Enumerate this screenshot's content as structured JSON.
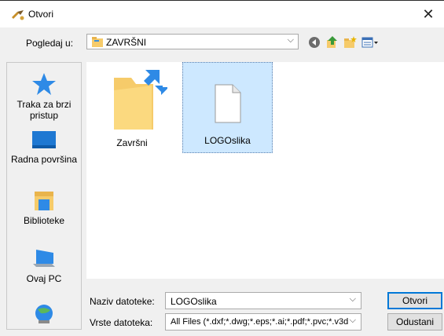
{
  "window": {
    "title": "Otvori",
    "close_symbol": "✕"
  },
  "lookin": {
    "label": "Pogledaj u:",
    "value": "ZAVRŠNI"
  },
  "places": [
    {
      "label": "Traka za brzi pristup",
      "icon": "quick-access-star-icon"
    },
    {
      "label": "Radna površina",
      "icon": "desktop-icon"
    },
    {
      "label": "Biblioteke",
      "icon": "libraries-icon"
    },
    {
      "label": "Ovaj PC",
      "icon": "this-pc-icon"
    },
    {
      "label": "",
      "icon": "network-icon"
    }
  ],
  "files": [
    {
      "name": "Završni",
      "icon": "folder-shortcut-icon",
      "selected": false
    },
    {
      "name": "LOGOslika",
      "icon": "blank-file-icon",
      "selected": true
    }
  ],
  "form": {
    "filename_label": "Naziv datoteke:",
    "filename_value": "LOGOslika",
    "filetype_label": "Vrste datoteka:",
    "filetype_value": "All Files (*.dxf;*.dwg;*.eps;*.ai;*.pdf;*.pvc;*.v3d;",
    "open_label": "Otvori",
    "cancel_label": "Odustani"
  },
  "colors": {
    "selection": "#cde8ff",
    "accent": "#0078d7",
    "folder": "#f6cb6a"
  }
}
